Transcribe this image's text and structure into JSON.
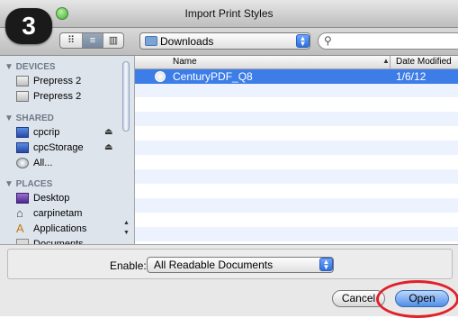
{
  "step_number": "3",
  "window": {
    "title": "Import Print Styles"
  },
  "toolbar": {
    "view_icon_glyph": "⠿",
    "view_list_glyph": "≡",
    "view_column_glyph": "▥",
    "location": "Downloads",
    "search_glyph": "⚲"
  },
  "sidebar": {
    "devices_header": "▼ DEVICES",
    "devices": [
      "Prepress 2",
      "Prepress 2"
    ],
    "shared_header": "▼ SHARED",
    "shared": [
      "cpcrip",
      "cpcStorage",
      "All..."
    ],
    "places_header": "▼ PLACES",
    "places": [
      "Desktop",
      "carpinetam",
      "Applications",
      "Documents"
    ]
  },
  "file_list": {
    "col_name": "Name",
    "col_date": "Date Modified",
    "sort_glyph": "▲",
    "files": [
      {
        "name": "CenturyPDF_Q8",
        "date": "1/6/12"
      }
    ]
  },
  "footer": {
    "enable_label": "Enable:",
    "enable_value": "All Readable Documents",
    "cancel_label": "Cancel",
    "open_label": "Open"
  },
  "colors": {
    "selection": "#3d7de8",
    "highlight_circle": "#e0202a",
    "sidebar_bg": "#dee4ec"
  }
}
